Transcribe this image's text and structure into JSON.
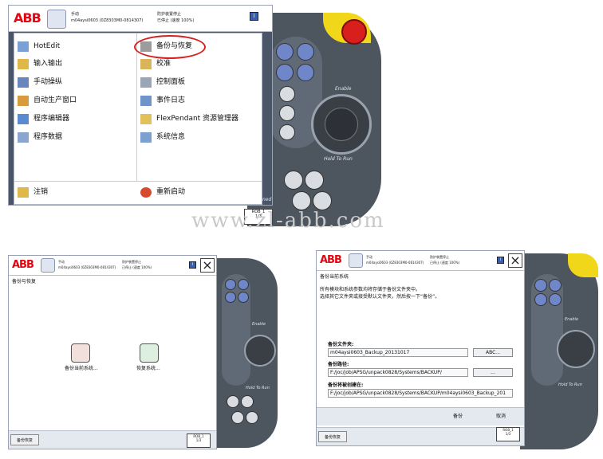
{
  "brand": "ABB",
  "status": {
    "line1_left": "手动",
    "line2_left": "m04aysi0603 (0Z8303M0-0814307)",
    "line1_right": "防护装置停止",
    "line2_right": "已停止 (速度 100%)"
  },
  "main_menu": {
    "left_items": [
      {
        "label": "HotEdit",
        "icon": "hotedit-icon"
      },
      {
        "label": "输入输出",
        "icon": "io-icon"
      },
      {
        "label": "手动操纵",
        "icon": "jogging-icon"
      },
      {
        "label": "自动生产窗口",
        "icon": "production-window-icon"
      },
      {
        "label": "程序编辑器",
        "icon": "program-editor-icon"
      },
      {
        "label": "程序数据",
        "icon": "program-data-icon"
      }
    ],
    "right_items": [
      {
        "label": "备份与恢复",
        "icon": "backup-restore-icon"
      },
      {
        "label": "校准",
        "icon": "calibration-icon"
      },
      {
        "label": "控制面板",
        "icon": "control-panel-icon"
      },
      {
        "label": "事件日志",
        "icon": "event-log-icon"
      },
      {
        "label": "FlexPendant 资源管理器",
        "icon": "explorer-icon"
      },
      {
        "label": "系统信息",
        "icon": "system-info-icon"
      }
    ],
    "logout": "注销",
    "restart": "重新启动",
    "side_text": "ned"
  },
  "quickset": {
    "label": "ROB_1",
    "sub": "1/3"
  },
  "watermark": "www.zl-abb.com",
  "backup_restore": {
    "title": "备份与恢复",
    "backup_label": "备份当前系统...",
    "restore_label": "恢复系统...",
    "taskbar": "备份恢复"
  },
  "backup_dialog": {
    "title": "备份当前系统",
    "instruction_1": "所有模块和系统参数均将存储于备份文件夹中。",
    "instruction_2": "选择其它文件夹或接受默认文件夹，然后按一下“备份”。",
    "folder_label": "备份文件夹:",
    "folder_value": "m04aysi0603_Backup_20131017",
    "folder_button": "ABC...",
    "path_label": "备份路径:",
    "path_value": "F:/joc/job/APSG/unpack0828/Systems/BACKUP/",
    "path_button": "...",
    "target_label": "备份将被创建在:",
    "target_value": "F:/joc/job/APSG/unpack0828/Systems/BACKUP/m04aysi0603_Backup_201",
    "backup_button": "备份",
    "cancel_button": "取消",
    "taskbar": "备份恢复"
  },
  "pendant": {
    "enable_label": "Enable",
    "hold_label": "Hold To Run"
  }
}
